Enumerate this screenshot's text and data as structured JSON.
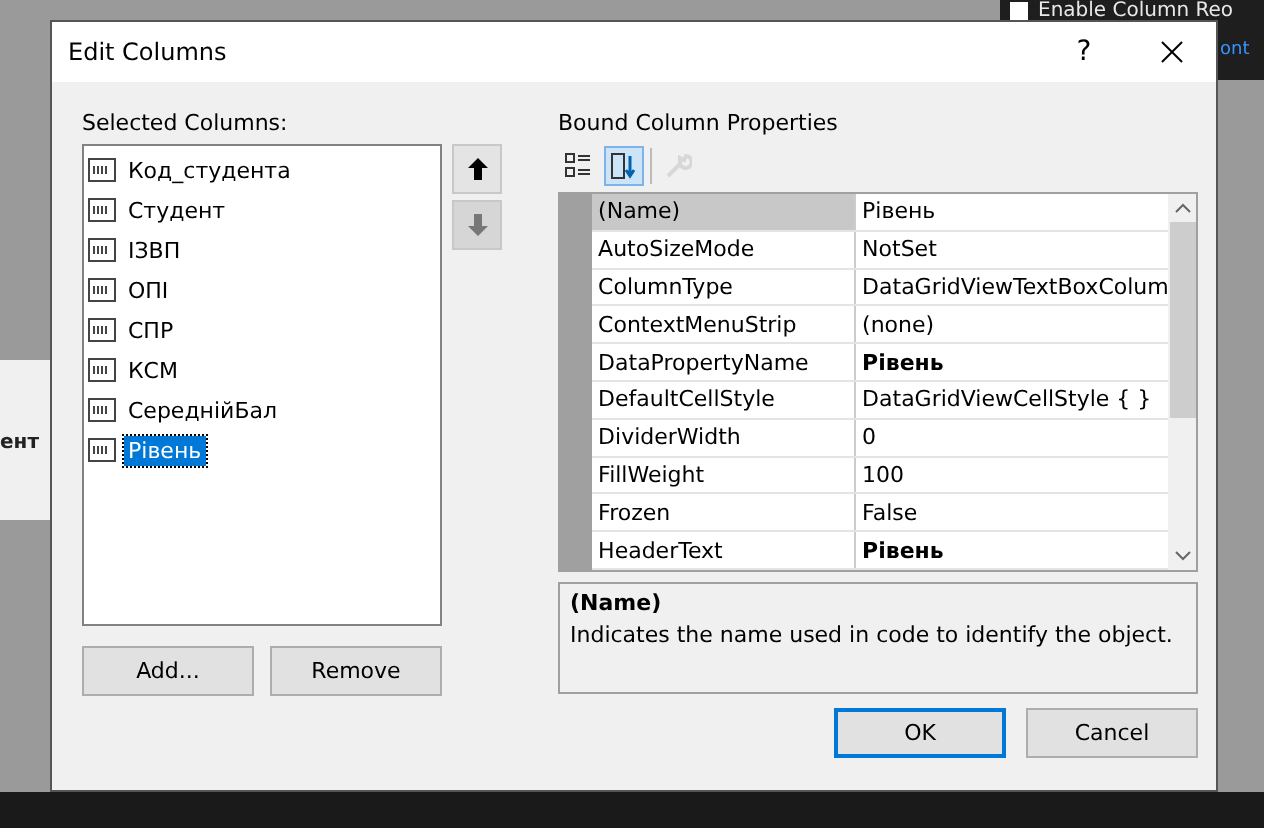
{
  "background": {
    "checkbox": {
      "label": "Enable Column Reo",
      "checked": false
    },
    "link": "ont",
    "fragment": "ент"
  },
  "dialog": {
    "title": "Edit Columns",
    "help": "?",
    "selected_columns": {
      "label": "Selected Columns:",
      "items": [
        {
          "label": "Код_студента",
          "selected": false
        },
        {
          "label": "Студент",
          "selected": false
        },
        {
          "label": "ІЗВП",
          "selected": false
        },
        {
          "label": "ОПІ",
          "selected": false
        },
        {
          "label": "СПР",
          "selected": false
        },
        {
          "label": "КСМ",
          "selected": false
        },
        {
          "label": "СереднійБал",
          "selected": false
        },
        {
          "label": "Рівень",
          "selected": true
        }
      ]
    },
    "move_buttons": [
      {
        "kind": "up",
        "disabled": false
      },
      {
        "kind": "down",
        "disabled": true
      }
    ],
    "list_buttons": [
      "Add...",
      "Remove"
    ],
    "properties": {
      "label": "Bound Column Properties",
      "toolbar": [
        {
          "kind": "categorized",
          "selected": false,
          "disabled": false
        },
        {
          "kind": "alphabetical",
          "selected": true,
          "disabled": false
        },
        {
          "kind": "property-pages",
          "selected": false,
          "disabled": true
        }
      ],
      "rows": [
        {
          "name": "(Name)",
          "value": "Рівень",
          "selected": true,
          "modified": false
        },
        {
          "name": "AutoSizeMode",
          "value": "NotSet",
          "selected": false,
          "modified": false
        },
        {
          "name": "ColumnType",
          "value": "DataGridViewTextBoxColum",
          "selected": false,
          "modified": false
        },
        {
          "name": "ContextMenuStrip",
          "value": "(none)",
          "selected": false,
          "modified": false
        },
        {
          "name": "DataPropertyName",
          "value": "Рівень",
          "selected": false,
          "modified": true
        },
        {
          "name": "DefaultCellStyle",
          "value": "DataGridViewCellStyle { }",
          "selected": false,
          "modified": false
        },
        {
          "name": "DividerWidth",
          "value": "0",
          "selected": false,
          "modified": false
        },
        {
          "name": "FillWeight",
          "value": "100",
          "selected": false,
          "modified": false
        },
        {
          "name": "Frozen",
          "value": "False",
          "selected": false,
          "modified": false
        },
        {
          "name": "HeaderText",
          "value": "Рівень",
          "selected": false,
          "modified": true
        }
      ],
      "description": {
        "title": "(Name)",
        "text": "Indicates the name used in code to identify the object."
      }
    },
    "buttons": [
      {
        "label": "OK",
        "default": true
      },
      {
        "label": "Cancel",
        "default": false
      }
    ]
  }
}
